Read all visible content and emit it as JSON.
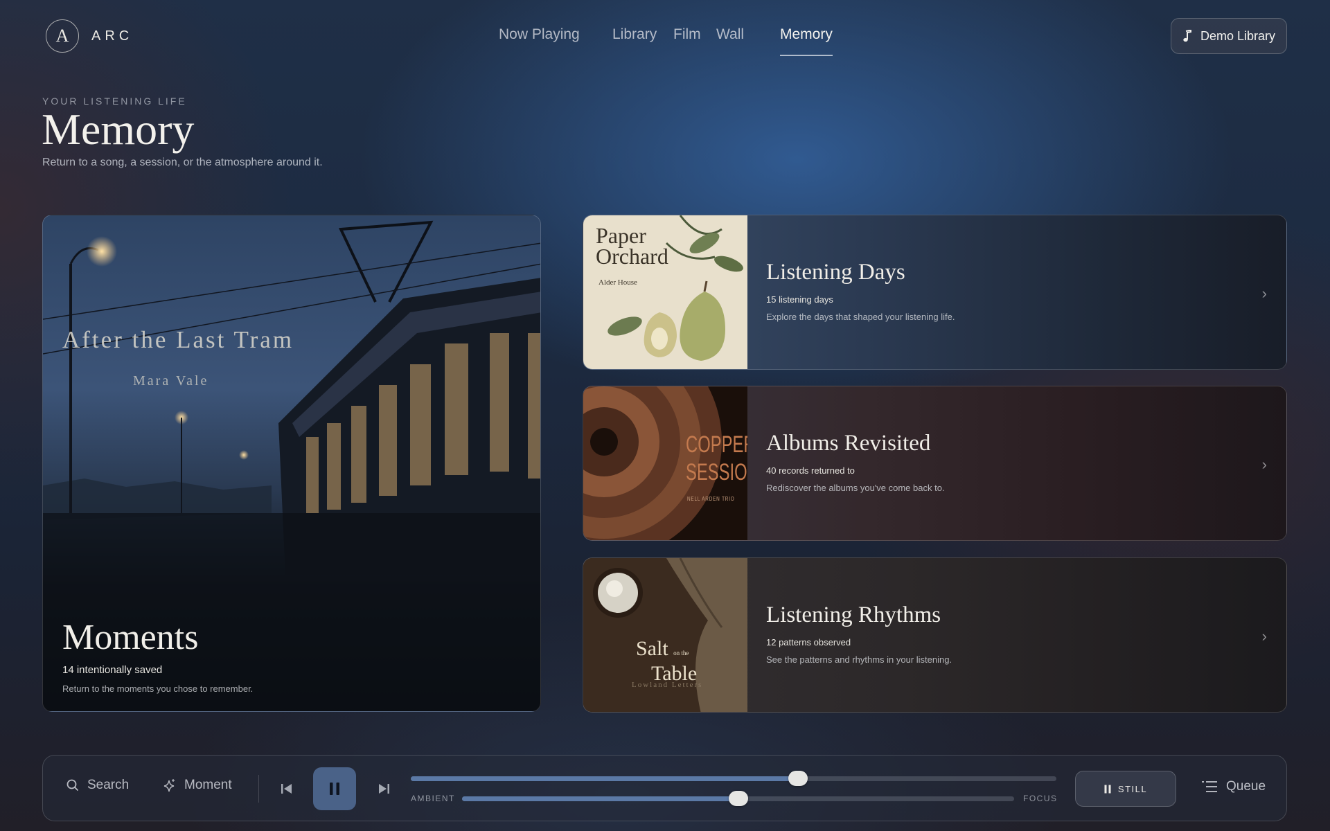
{
  "brand": {
    "logo_letter": "A",
    "name": "ARC"
  },
  "nav": {
    "items": [
      {
        "label": "Now Playing",
        "active": false
      },
      {
        "label": "Library",
        "active": false
      },
      {
        "label": "Film",
        "active": false
      },
      {
        "label": "Wall",
        "active": false
      },
      {
        "label": "Memory",
        "active": true
      }
    ]
  },
  "header": {
    "library_button": "Demo Library",
    "library_icon": "music-note-icon"
  },
  "page": {
    "eyebrow": "YOUR LISTENING LIFE",
    "title": "Memory",
    "subtitle": "Return to a song, a session, or the atmosphere around it."
  },
  "moments": {
    "album_title": "After the Last Tram",
    "album_artist": "Mara Vale",
    "title": "Moments",
    "count": "14 intentionally saved",
    "description": "Return to the moments you chose to remember."
  },
  "cards": [
    {
      "title": "Listening Days",
      "stat": "15 listening days",
      "description": "Explore the days that shaped your listening life.",
      "art": {
        "title_line1": "Paper",
        "title_line2": "Orchard",
        "artist": "Alder House"
      }
    },
    {
      "title": "Albums Revisited",
      "stat": "40 records returned to",
      "description": "Rediscover the albums you've come back to.",
      "art": {
        "title_line1": "COPPER",
        "title_line2": "SESSION",
        "artist": "NELL ARDEN TRIO"
      }
    },
    {
      "title": "Listening Rhythms",
      "stat": "12 patterns observed",
      "description": "See the patterns and rhythms in your listening.",
      "art": {
        "title_word1": "Salt",
        "title_small": "on the",
        "title_word2": "Table",
        "artist": "Lowland Letters"
      }
    }
  ],
  "player": {
    "search_label": "Search",
    "moment_label": "Moment",
    "progress": 0.6,
    "mix_left_label": "AMBIENT",
    "mix_right_label": "FOCUS",
    "mix_value": 0.5,
    "still_label": "STILL",
    "queue_label": "Queue",
    "state": "playing"
  },
  "colors": {
    "accent": "#4a6288",
    "progress": "#5b79a6"
  }
}
